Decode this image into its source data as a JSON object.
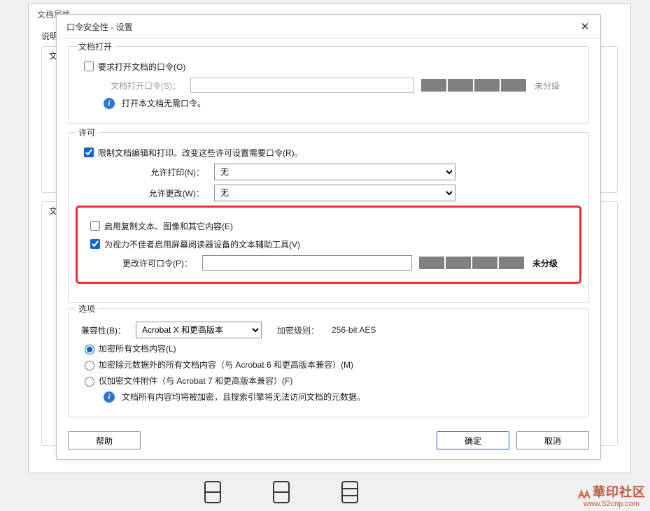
{
  "outer": {
    "title": "文档属性",
    "desc_label": "说明",
    "sec_label": "文"
  },
  "dialog": {
    "title": "口令安全性 - 设置",
    "section_open": {
      "legend": "文档打开",
      "require_open_pw": "要求打开文档的口令(O)",
      "open_pw_label": "文档打开口令(S)：",
      "strength_txt": "未分级",
      "info": "打开本文档无需口令。"
    },
    "section_perm": {
      "legend": "许可",
      "restrict": "限制文档编辑和打印。改变这些许可设置需要口令(R)。",
      "allow_print_label": "允许打印(N)：",
      "allow_print_val": "无",
      "allow_change_label": "允许更改(W)：",
      "allow_change_val": "无",
      "enable_copy": "启用复制文本、图像和其它内容(E)",
      "enable_reader": "为视力不佳者启用屏幕阅读器设备的文本辅助工具(V)",
      "change_pw_label": "更改许可口令(P)：",
      "strength_txt": "未分级"
    },
    "section_opts": {
      "legend": "选项",
      "compat_label": "兼容性(B)：",
      "compat_val": "Acrobat X 和更高版本",
      "enc_level_label": "加密级别：",
      "enc_level_val": "256-bit AES",
      "opt_all": "加密所有文档内容(L)",
      "opt_meta": "加密除元数据外的所有文档内容（与 Acrobat 6 和更高版本兼容）(M)",
      "opt_attach": "仅加密文件附件（与 Acrobat 7 和更高版本兼容）(F)",
      "info": "文档所有内容均将被加密，且搜索引擎将无法访问文档的元数据。"
    },
    "buttons": {
      "help": "帮助",
      "ok": "确定",
      "cancel": "取消"
    }
  },
  "watermark": {
    "cn": "華印社区",
    "url": "www.52cnp.com"
  }
}
